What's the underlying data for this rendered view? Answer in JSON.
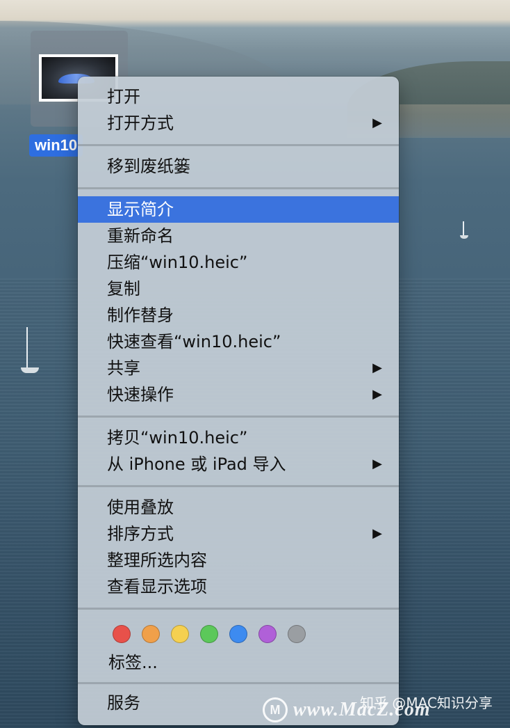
{
  "desktop": {
    "file_name_visible": "win10"
  },
  "context_menu": {
    "groups": [
      [
        {
          "label": "打开",
          "submenu": false
        },
        {
          "label": "打开方式",
          "submenu": true
        }
      ],
      [
        {
          "label": "移到废纸篓",
          "submenu": false
        }
      ],
      [
        {
          "label": "显示简介",
          "submenu": false,
          "highlighted": true
        },
        {
          "label": "重新命名",
          "submenu": false
        },
        {
          "label": "压缩“win10.heic”",
          "submenu": false
        },
        {
          "label": "复制",
          "submenu": false
        },
        {
          "label": "制作替身",
          "submenu": false
        },
        {
          "label": "快速查看“win10.heic”",
          "submenu": false
        },
        {
          "label": "共享",
          "submenu": true
        },
        {
          "label": "快速操作",
          "submenu": true
        }
      ],
      [
        {
          "label": "拷贝“win10.heic”",
          "submenu": false
        },
        {
          "label": "从 iPhone 或 iPad 导入",
          "submenu": true
        }
      ],
      [
        {
          "label": "使用叠放",
          "submenu": false
        },
        {
          "label": "排序方式",
          "submenu": true
        },
        {
          "label": "整理所选内容",
          "submenu": false
        },
        {
          "label": "查看显示选项",
          "submenu": false
        }
      ]
    ],
    "tag_colors": [
      "#e8514a",
      "#f0a04a",
      "#f5d050",
      "#5cc85a",
      "#3d8bf0",
      "#b060d8",
      "#9a9ea2"
    ],
    "tags_label": "标签...",
    "services_label": "服务",
    "arrow_glyph": "▶"
  },
  "watermark": {
    "logo": "M",
    "text": "www.MacZ.com",
    "zh": "知乎 @MAC知识分享"
  },
  "colors": {
    "highlight": "#3b73de",
    "selection_label": "#2e6ee0"
  }
}
